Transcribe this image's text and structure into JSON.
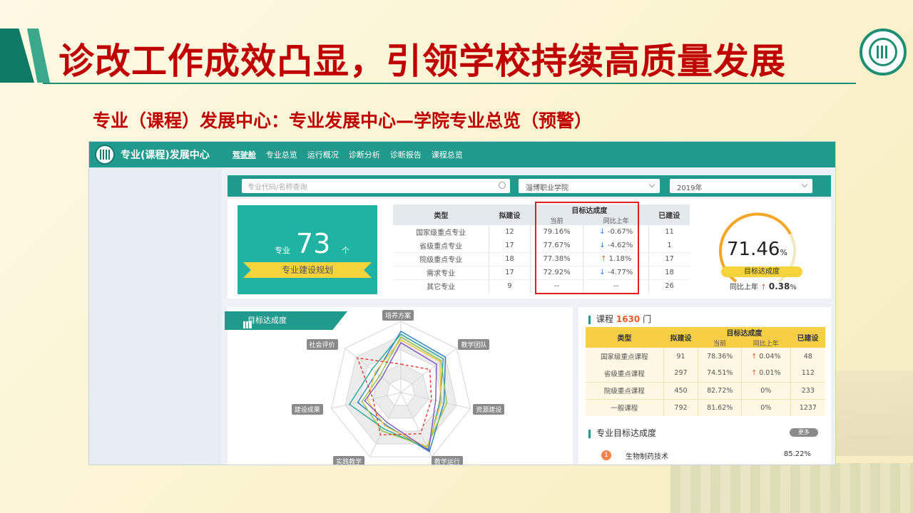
{
  "slide": {
    "title": "诊改工作成效凸显，引领学校持续高质量发展",
    "subtitle": "专业（课程）发展中心：专业发展中心—学院专业总览（预警）"
  },
  "app": {
    "name": "专业(课程)发展中心",
    "nav": [
      "驾驶舱",
      "专业总览",
      "运行概况",
      "诊断分析",
      "诊断报告",
      "课程总览"
    ],
    "active_nav": "驾驶舱"
  },
  "filters": {
    "search_placeholder": "专业代码/名称查询",
    "college": "淄博职业学院",
    "year": "2019年"
  },
  "major_summary": {
    "label": "专业",
    "count": "73",
    "unit": "个",
    "button": "专业建设规划"
  },
  "major_table": {
    "headers": {
      "type": "类型",
      "planned": "拟建设",
      "target": "目标达成度",
      "current": "当前",
      "yoy": "同比上年",
      "built": "已建设"
    },
    "rows": [
      {
        "type": "国家级重点专业",
        "planned": "12",
        "current": "79.16%",
        "yoy": "-0.67%",
        "dir": "down",
        "built": "11"
      },
      {
        "type": "省级重点专业",
        "planned": "17",
        "current": "77.67%",
        "yoy": "-4.62%",
        "dir": "down",
        "built": "1"
      },
      {
        "type": "院级重点专业",
        "planned": "18",
        "current": "77.38%",
        "yoy": "1.18%",
        "dir": "up",
        "built": "17"
      },
      {
        "type": "需求专业",
        "planned": "17",
        "current": "72.92%",
        "yoy": "-4.77%",
        "dir": "down",
        "built": "18"
      },
      {
        "type": "其它专业",
        "planned": "9",
        "current": "--",
        "yoy": "--",
        "dir": "none",
        "built": "26"
      }
    ]
  },
  "gauge": {
    "value": "71.46",
    "unit": "%",
    "fraction": 0.7146,
    "label": "目标达成度",
    "yoy_label": "同比上年",
    "yoy_value": "0.38",
    "yoy_unit": "%"
  },
  "radar": {
    "tab": "目标达成度",
    "axes": [
      "培养方案",
      "教学团队",
      "资源建设",
      "教学运行",
      "实践教学",
      "建设成果",
      "社会评价"
    ],
    "colors": [
      "#2e7fc2",
      "#26a69a",
      "#8bc34a",
      "#f4c542",
      "#7e57c2",
      "#e53935"
    ]
  },
  "course": {
    "title_prefix": "课程",
    "count": "1630",
    "unit": "门",
    "headers": {
      "type": "类型",
      "planned": "拟建设",
      "target": "目标达成度",
      "current": "当前",
      "yoy": "同比上年",
      "built": "已建设"
    },
    "rows": [
      {
        "type": "国家级重点课程",
        "planned": "91",
        "current": "78.36%",
        "yoy": "0.04%",
        "dir": "up",
        "built": "48"
      },
      {
        "type": "省级重点课程",
        "planned": "297",
        "current": "74.51%",
        "yoy": "0.01%",
        "dir": "up",
        "built": "112"
      },
      {
        "type": "院级重点课程",
        "planned": "450",
        "current": "82.72%",
        "yoy": "0%",
        "dir": "none",
        "built": "233"
      },
      {
        "type": "一般课程",
        "planned": "792",
        "current": "81.62%",
        "yoy": "0%",
        "dir": "none",
        "built": "1237"
      }
    ]
  },
  "major_target": {
    "title": "专业目标达成度",
    "more": "更多",
    "items": [
      {
        "rank": "1",
        "name": "生物制药技术",
        "value": "85.22%"
      }
    ]
  }
}
